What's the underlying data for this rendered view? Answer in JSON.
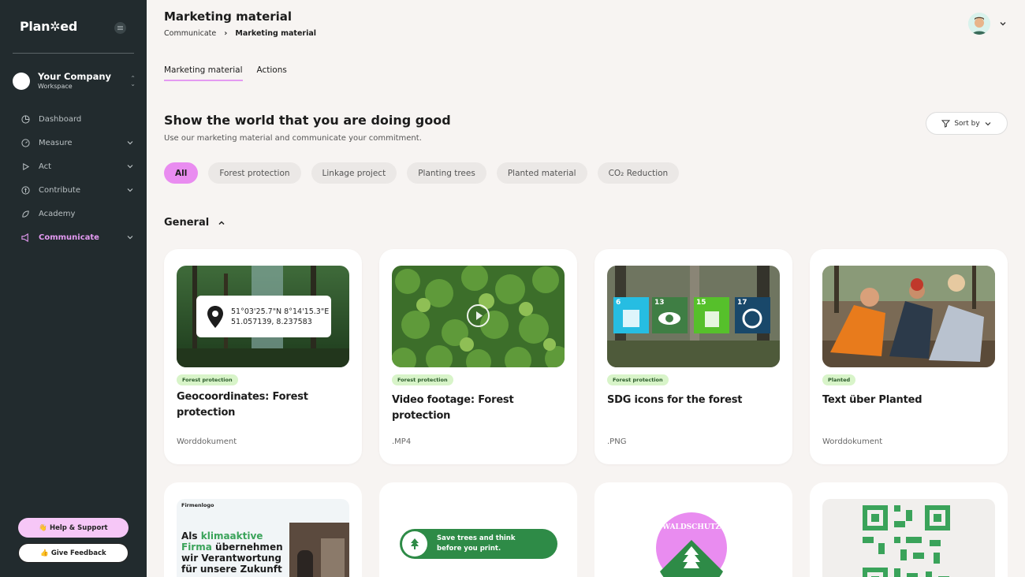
{
  "sidebar": {
    "brand": "Plan✲ed",
    "workspace": {
      "name": "Your Company",
      "sub": "Workspace"
    },
    "items": [
      {
        "label": "Dashboard",
        "icon": "pie-chart-icon",
        "expandable": false
      },
      {
        "label": "Measure",
        "icon": "gauge-icon",
        "expandable": true
      },
      {
        "label": "Act",
        "icon": "play-icon",
        "expandable": true
      },
      {
        "label": "Contribute",
        "icon": "coin-icon",
        "expandable": true
      },
      {
        "label": "Academy",
        "icon": "leaf-icon",
        "expandable": false
      },
      {
        "label": "Communicate",
        "icon": "megaphone-icon",
        "expandable": true,
        "active": true
      }
    ],
    "help_label": "👋 Help & Support",
    "feedback_label": "👍 Give Feedback"
  },
  "header": {
    "title": "Marketing material",
    "breadcrumb": [
      "Communicate",
      "Marketing material"
    ]
  },
  "tabs": [
    {
      "label": "Marketing material",
      "active": true
    },
    {
      "label": "Actions",
      "active": false
    }
  ],
  "section": {
    "title": "Show the world that you are doing good",
    "subtitle": "Use our marketing material and communicate your commitment.",
    "sort_label": "Sort by"
  },
  "filters": [
    "All",
    "Forest protection",
    "Linkage project",
    "Planting trees",
    "Planted material",
    "CO₂ Reduction"
  ],
  "group": {
    "title": "General"
  },
  "cards": [
    {
      "badge": "Forest protection",
      "title": "Geocoordinates: Forest protection",
      "type": "Worddokument",
      "coords": [
        "51°03'25.7\"N 8°14'15.3\"E",
        "51.057139, 8.237583"
      ]
    },
    {
      "badge": "Forest protection",
      "title": "Video footage: Forest protection",
      "type": ".MP4"
    },
    {
      "badge": "Forest protection",
      "title": "SDG icons for the forest",
      "type": ".PNG",
      "sdg": [
        "6",
        "13",
        "15",
        "17"
      ]
    },
    {
      "badge": "Planted",
      "title": "Text über Planted",
      "type": "Worddokument"
    }
  ],
  "cards_row2": {
    "logo_card": {
      "label": "Firmenlogo",
      "line1": "Als ",
      "highlight1": "klimaaktive",
      "line2a": "Firma",
      "line2b": " übernehmen",
      "line3": "wir Verantwortung",
      "line4": "für unsere Zukunft"
    },
    "print_card": {
      "line1": "Save trees and think",
      "line2": "before you print."
    },
    "seal_card": {
      "text": "WALDSCHUTZ"
    }
  },
  "colors": {
    "accent": "#e98cf0",
    "sidebar": "#222b2e",
    "badge": "#d8f4c9",
    "green": "#2e8b47"
  }
}
